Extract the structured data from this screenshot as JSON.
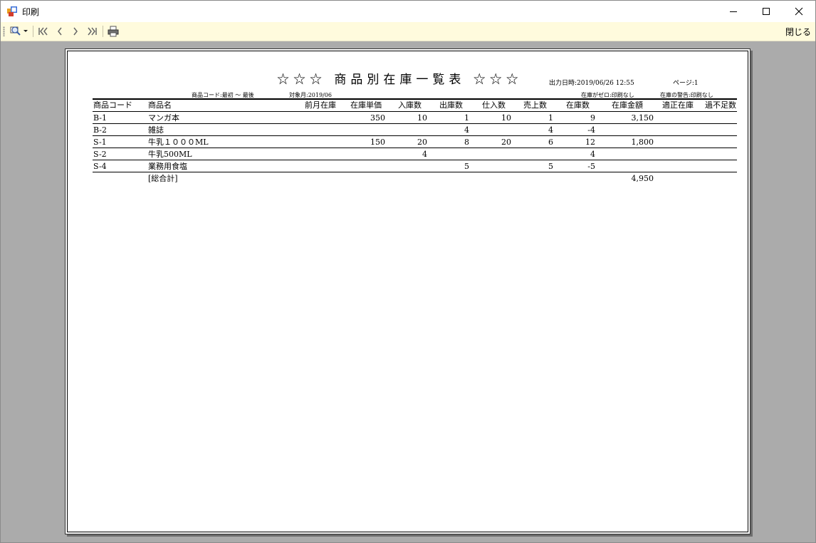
{
  "window": {
    "title": "印刷",
    "close_label": "閉じる"
  },
  "toolbar": {
    "icons": [
      "zoom-icon",
      "first-page-icon",
      "prev-page-icon",
      "next-page-icon",
      "last-page-icon",
      "print-icon"
    ]
  },
  "report": {
    "title": "☆☆☆ 商品別在庫一覧表 ☆☆☆",
    "output_datetime": "出力日時:2019/06/26 12:55",
    "page": "ページ:1",
    "condition_code": "商品コード:最初 ～ 最後",
    "condition_month": "対象月:2019/06",
    "option_zero": "在庫がゼロ:印刷なし",
    "option_warning": "在庫の警告:印刷なし",
    "headers": [
      "商品コード",
      "商品名",
      "前月在庫",
      "在庫単価",
      "入庫数",
      "出庫数",
      "仕入数",
      "売上数",
      "在庫数",
      "在庫金額",
      "適正在庫",
      "過不足数"
    ],
    "rows": [
      {
        "code": "B-1",
        "name": "マンガ本",
        "prev": "",
        "unit_price": "350",
        "in": "10",
        "out": "1",
        "purchase": "10",
        "sales": "1",
        "stock": "9",
        "amount": "3,150",
        "proper": "",
        "diff": ""
      },
      {
        "code": "B-2",
        "name": "雑誌",
        "prev": "",
        "unit_price": "",
        "in": "",
        "out": "4",
        "purchase": "",
        "sales": "4",
        "stock": "-4",
        "amount": "",
        "proper": "",
        "diff": ""
      },
      {
        "code": "S-1",
        "name": "牛乳１０００ML",
        "prev": "",
        "unit_price": "150",
        "in": "20",
        "out": "8",
        "purchase": "20",
        "sales": "6",
        "stock": "12",
        "amount": "1,800",
        "proper": "",
        "diff": ""
      },
      {
        "code": "S-2",
        "name": "牛乳500ML",
        "prev": "",
        "unit_price": "",
        "in": "4",
        "out": "",
        "purchase": "",
        "sales": "",
        "stock": "4",
        "amount": "",
        "proper": "",
        "diff": ""
      },
      {
        "code": "S-4",
        "name": "業務用食塩",
        "prev": "",
        "unit_price": "",
        "in": "",
        "out": "5",
        "purchase": "",
        "sales": "5",
        "stock": "-5",
        "amount": "",
        "proper": "",
        "diff": ""
      }
    ],
    "total_label": "[総合計]",
    "total_amount": "4,950"
  }
}
